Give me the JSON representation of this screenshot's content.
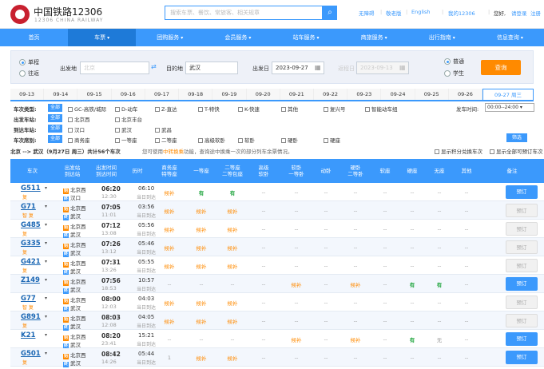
{
  "header": {
    "logo_cn": "中国铁路12306",
    "logo_en": "12306 CHINA RAILWAY",
    "search_placeholder": "搜索车票、餐饮、常旅客、相关规章",
    "links": [
      "无障碍",
      "敬老版",
      "English",
      "我的12306",
      "您好, 请登录",
      "注册"
    ],
    "greeting": "您好,",
    "login": "请登录",
    "register": "注册"
  },
  "nav": [
    {
      "label": "首页",
      "active": false
    },
    {
      "label": "车票",
      "active": true
    },
    {
      "label": "团购服务",
      "active": false
    },
    {
      "label": "会员服务",
      "active": false
    },
    {
      "label": "站车服务",
      "active": false
    },
    {
      "label": "商旅服务",
      "active": false
    },
    {
      "label": "出行指南",
      "active": false
    },
    {
      "label": "信息查询",
      "active": false
    }
  ],
  "query": {
    "trip_oneway": "单程",
    "trip_round": "往返",
    "from_label": "出发地",
    "from_value": "北京",
    "to_label": "目的地",
    "to_value": "武汉",
    "date_label": "出发日",
    "date_value": "2023-09-27",
    "return_label": "返程日",
    "return_value": "2023-09-13",
    "passenger_normal": "普通",
    "passenger_student": "学生",
    "query_button": "查询"
  },
  "dates": [
    "09-13",
    "09-14",
    "09-15",
    "09-16",
    "09-17",
    "09-18",
    "09-19",
    "09-20",
    "09-21",
    "09-22",
    "09-23",
    "09-24",
    "09-25",
    "09-26",
    "09-27 周三"
  ],
  "filters": {
    "type_label": "车次类型:",
    "from_label": "出发车站:",
    "to_label": "到达车站:",
    "seat_label": "车次席别:",
    "all": "全部",
    "types": [
      "GC-高铁/城际",
      "D-动车",
      "Z-直达",
      "T-特快",
      "K-快速",
      "其他",
      "复兴号",
      "智能动车组"
    ],
    "from_stations": [
      "北京西",
      "北京丰台"
    ],
    "to_stations": [
      "汉口",
      "武汉",
      "武昌"
    ],
    "seats": [
      "商务座",
      "一等座",
      "二等座",
      "高级软卧",
      "软卧",
      "硬卧",
      "硬座"
    ],
    "depart_time_label": "发车时间:",
    "depart_time_value": "00:00--24:00",
    "filter_button": "筛选"
  },
  "summary": {
    "route": "北京 --> 武汉（9月27日 周三）共计56个车次",
    "tip_pre": "您可使用",
    "tip_link": "中转换乘",
    "tip_post": "功能，查询途中换乘一次的部分列车余票情况。",
    "opt_points": "显示积分兑换车次",
    "opt_all": "显示全部可预订车次"
  },
  "columns": [
    "车次",
    "出发站\n到达站",
    "出发时间\n到达时间",
    "历时",
    "商务座\n特等座",
    "一等座",
    "二等座\n二等包座",
    "高级\n软卧",
    "软卧\n一等卧",
    "动卧",
    "硬卧\n二等卧",
    "软座",
    "硬座",
    "无座",
    "其他",
    "备注"
  ],
  "trains": [
    {
      "no": "G511",
      "sub": "复",
      "from": "北京西",
      "to": "汉口",
      "dep": "06:20",
      "arr": "12:30",
      "dur": "06:10",
      "day": "当日到达",
      "seats": [
        "候补",
        "有",
        "有",
        "--",
        "--",
        "--",
        "--",
        "--",
        "--",
        "--",
        "--"
      ],
      "book": "预订",
      "book_on": true
    },
    {
      "no": "G71",
      "sub": "智 复",
      "from": "北京西",
      "to": "武汉",
      "dep": "07:05",
      "arr": "11:01",
      "dur": "03:56",
      "day": "当日到达",
      "seats": [
        "候补",
        "候补",
        "候补",
        "--",
        "--",
        "--",
        "--",
        "--",
        "--",
        "--",
        "--"
      ],
      "book": "预订",
      "book_on": false
    },
    {
      "no": "G485",
      "sub": "复",
      "from": "北京西",
      "to": "武汉",
      "dep": "07:12",
      "arr": "13:08",
      "dur": "05:56",
      "day": "当日到达",
      "seats": [
        "候补",
        "候补",
        "候补",
        "--",
        "--",
        "--",
        "--",
        "--",
        "--",
        "--",
        "--"
      ],
      "book": "预订",
      "book_on": false
    },
    {
      "no": "G335",
      "sub": "复",
      "from": "北京西",
      "to": "武汉",
      "dep": "07:26",
      "arr": "13:12",
      "dur": "05:46",
      "day": "当日到达",
      "seats": [
        "候补",
        "候补",
        "候补",
        "--",
        "--",
        "--",
        "--",
        "--",
        "--",
        "--",
        "--"
      ],
      "book": "预订",
      "book_on": false
    },
    {
      "no": "G421",
      "sub": "复",
      "from": "北京西",
      "to": "武汉",
      "dep": "07:31",
      "arr": "13:26",
      "dur": "05:55",
      "day": "当日到达",
      "seats": [
        "候补",
        "候补",
        "候补",
        "--",
        "--",
        "--",
        "--",
        "--",
        "--",
        "--",
        "--"
      ],
      "book": "预订",
      "book_on": false
    },
    {
      "no": "Z149",
      "sub": "",
      "from": "北京西",
      "to": "武汉",
      "dep": "07:56",
      "arr": "18:53",
      "dur": "10:57",
      "day": "当日到达",
      "seats": [
        "--",
        "--",
        "--",
        "--",
        "候补",
        "--",
        "候补",
        "--",
        "有",
        "有",
        "--"
      ],
      "book": "预订",
      "book_on": true
    },
    {
      "no": "G77",
      "sub": "智 复",
      "from": "北京西",
      "to": "武汉",
      "dep": "08:00",
      "arr": "12:03",
      "dur": "04:03",
      "day": "当日到达",
      "seats": [
        "候补",
        "候补",
        "候补",
        "--",
        "--",
        "--",
        "--",
        "--",
        "--",
        "--",
        "--"
      ],
      "book": "预订",
      "book_on": false
    },
    {
      "no": "G891",
      "sub": "复",
      "from": "北京西",
      "to": "武汉",
      "dep": "08:03",
      "arr": "12:08",
      "dur": "04:05",
      "day": "当日到达",
      "seats": [
        "候补",
        "候补",
        "候补",
        "--",
        "--",
        "--",
        "--",
        "--",
        "--",
        "--",
        "--"
      ],
      "book": "预订",
      "book_on": false
    },
    {
      "no": "K21",
      "sub": "",
      "from": "北京西",
      "to": "武汉",
      "dep": "08:20",
      "arr": "23:41",
      "dur": "15:21",
      "day": "当日到达",
      "seats": [
        "--",
        "--",
        "--",
        "--",
        "候补",
        "--",
        "候补",
        "--",
        "有",
        "无",
        "--"
      ],
      "book": "预订",
      "book_on": true
    },
    {
      "no": "G501",
      "sub": "复",
      "from": "北京西",
      "to": "武汉",
      "dep": "08:42",
      "arr": "14:26",
      "dur": "05:44",
      "day": "当日到达",
      "seats": [
        "1",
        "候补",
        "候补",
        "--",
        "--",
        "--",
        "--",
        "--",
        "--",
        "--",
        "--"
      ],
      "book": "预订",
      "book_on": true
    }
  ],
  "colors": {
    "accent": "#3b99fc",
    "orange": "#ff8a00",
    "green": "#27a844"
  }
}
